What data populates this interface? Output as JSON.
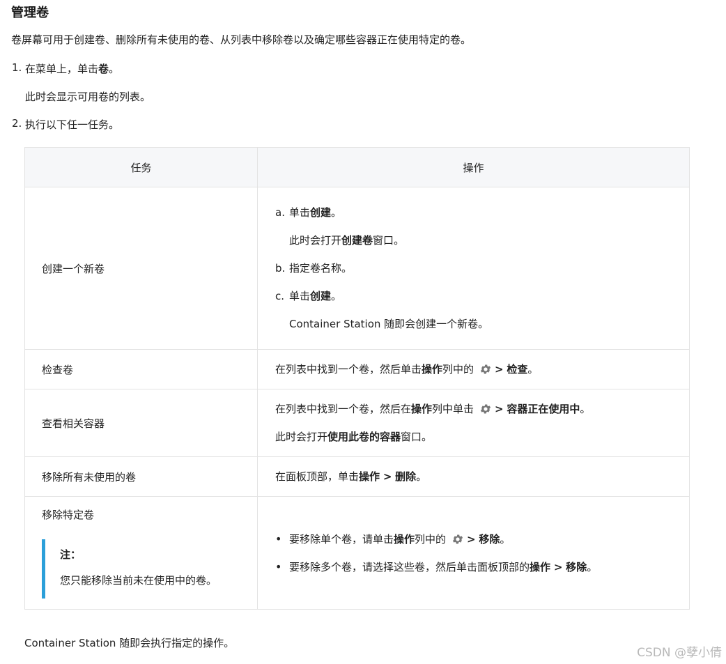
{
  "heading": "管理卷",
  "intro": "卷屏幕可用于创建卷、删除所有未使用的卷、从列表中移除卷以及确定哪些容器正在使用特定的卷。",
  "steps": [
    {
      "num": "1.",
      "pre": "在菜单上，单击",
      "bold": "卷",
      "post": "。",
      "sub": "此时会显示可用卷的列表。"
    },
    {
      "num": "2.",
      "text": "执行以下任一任务。"
    }
  ],
  "table": {
    "headers": [
      "任务",
      "操作"
    ],
    "rows": [
      {
        "task": "创建一个新卷",
        "a_label": "a.",
        "a_pre": "单击",
        "a_bold": "创建",
        "a_post": "。",
        "a_sub_pre": "此时会打开",
        "a_sub_bold": "创建卷",
        "a_sub_post": "窗口。",
        "b_label": "b.",
        "b_text": "指定卷名称。",
        "c_label": "c.",
        "c_pre": "单击",
        "c_bold": "创建",
        "c_post": "。",
        "c_sub": "Container Station 随即会创建一个新卷。"
      },
      {
        "task": "检查卷",
        "pre": "在列表中找到一个卷，然后单击",
        "bold1": "操作",
        "mid": "列中的",
        "gt": ">",
        "bold2": "检查",
        "post": "。"
      },
      {
        "task": "查看相关容器",
        "pre": "在列表中找到一个卷，然后在",
        "bold1": "操作",
        "mid": "列中单击",
        "gt": ">",
        "bold2": "容器正在使用中",
        "post": "。",
        "l2_pre": "此时会打开",
        "l2_bold": "使用此卷的容器",
        "l2_post": "窗口。"
      },
      {
        "task": "移除所有未使用的卷",
        "pre": "在面板顶部，单击",
        "bold1": "操作",
        "gt": ">",
        "bold2": "删除",
        "post": "。"
      },
      {
        "task": "移除特定卷",
        "note_title": "注：",
        "note_text": "您只能移除当前未在使用中的卷。",
        "bullets": [
          {
            "pre": "要移除单个卷，请单击",
            "bold1": "操作",
            "mid": "列中的",
            "gt": ">",
            "bold2": "移除",
            "post": "。"
          },
          {
            "pre": "要移除多个卷，请选择这些卷，然后单击面板顶部的",
            "bold1": "操作",
            "gt": ">",
            "bold2": "移除",
            "post": "。"
          }
        ]
      }
    ]
  },
  "outro": "Container Station 随即会执行指定的操作。",
  "watermark": "CSDN @孽小倩",
  "icons": {
    "gear": "gear-icon"
  },
  "colors": {
    "note_bar": "#2b9fd9",
    "header_bg": "#f6f7f9",
    "border": "#e3e3e3"
  }
}
